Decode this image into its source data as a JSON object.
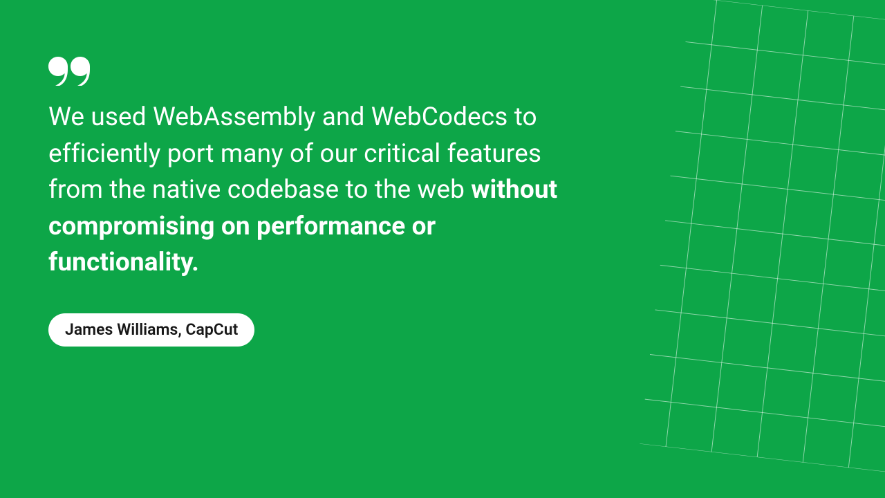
{
  "quote": {
    "text_normal": "We used WebAssembly and WebCodecs to efficiently port many of our critical features from the native codebase to the web ",
    "text_bold": "without compromising on performance or functionality.",
    "attribution": "James Williams, CapCut"
  },
  "colors": {
    "background": "#0DA648",
    "text": "#FFFFFF",
    "pill_bg": "#FFFFFF",
    "pill_text": "#171717",
    "grid_line": "rgba(255,255,255,0.55)"
  }
}
